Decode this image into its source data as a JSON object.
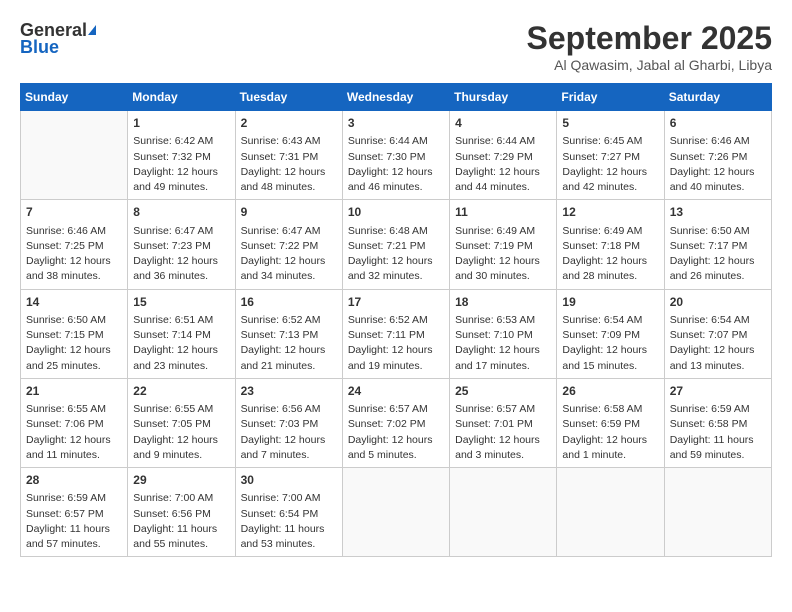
{
  "logo": {
    "general": "General",
    "blue": "Blue"
  },
  "title": "September 2025",
  "location": "Al Qawasim, Jabal al Gharbi, Libya",
  "days_of_week": [
    "Sunday",
    "Monday",
    "Tuesday",
    "Wednesday",
    "Thursday",
    "Friday",
    "Saturday"
  ],
  "weeks": [
    [
      {
        "day": "",
        "sunrise": "",
        "sunset": "",
        "daylight": "",
        "empty": true
      },
      {
        "day": "1",
        "sunrise": "Sunrise: 6:42 AM",
        "sunset": "Sunset: 7:32 PM",
        "daylight": "Daylight: 12 hours and 49 minutes."
      },
      {
        "day": "2",
        "sunrise": "Sunrise: 6:43 AM",
        "sunset": "Sunset: 7:31 PM",
        "daylight": "Daylight: 12 hours and 48 minutes."
      },
      {
        "day": "3",
        "sunrise": "Sunrise: 6:44 AM",
        "sunset": "Sunset: 7:30 PM",
        "daylight": "Daylight: 12 hours and 46 minutes."
      },
      {
        "day": "4",
        "sunrise": "Sunrise: 6:44 AM",
        "sunset": "Sunset: 7:29 PM",
        "daylight": "Daylight: 12 hours and 44 minutes."
      },
      {
        "day": "5",
        "sunrise": "Sunrise: 6:45 AM",
        "sunset": "Sunset: 7:27 PM",
        "daylight": "Daylight: 12 hours and 42 minutes."
      },
      {
        "day": "6",
        "sunrise": "Sunrise: 6:46 AM",
        "sunset": "Sunset: 7:26 PM",
        "daylight": "Daylight: 12 hours and 40 minutes."
      }
    ],
    [
      {
        "day": "7",
        "sunrise": "Sunrise: 6:46 AM",
        "sunset": "Sunset: 7:25 PM",
        "daylight": "Daylight: 12 hours and 38 minutes."
      },
      {
        "day": "8",
        "sunrise": "Sunrise: 6:47 AM",
        "sunset": "Sunset: 7:23 PM",
        "daylight": "Daylight: 12 hours and 36 minutes."
      },
      {
        "day": "9",
        "sunrise": "Sunrise: 6:47 AM",
        "sunset": "Sunset: 7:22 PM",
        "daylight": "Daylight: 12 hours and 34 minutes."
      },
      {
        "day": "10",
        "sunrise": "Sunrise: 6:48 AM",
        "sunset": "Sunset: 7:21 PM",
        "daylight": "Daylight: 12 hours and 32 minutes."
      },
      {
        "day": "11",
        "sunrise": "Sunrise: 6:49 AM",
        "sunset": "Sunset: 7:19 PM",
        "daylight": "Daylight: 12 hours and 30 minutes."
      },
      {
        "day": "12",
        "sunrise": "Sunrise: 6:49 AM",
        "sunset": "Sunset: 7:18 PM",
        "daylight": "Daylight: 12 hours and 28 minutes."
      },
      {
        "day": "13",
        "sunrise": "Sunrise: 6:50 AM",
        "sunset": "Sunset: 7:17 PM",
        "daylight": "Daylight: 12 hours and 26 minutes."
      }
    ],
    [
      {
        "day": "14",
        "sunrise": "Sunrise: 6:50 AM",
        "sunset": "Sunset: 7:15 PM",
        "daylight": "Daylight: 12 hours and 25 minutes."
      },
      {
        "day": "15",
        "sunrise": "Sunrise: 6:51 AM",
        "sunset": "Sunset: 7:14 PM",
        "daylight": "Daylight: 12 hours and 23 minutes."
      },
      {
        "day": "16",
        "sunrise": "Sunrise: 6:52 AM",
        "sunset": "Sunset: 7:13 PM",
        "daylight": "Daylight: 12 hours and 21 minutes."
      },
      {
        "day": "17",
        "sunrise": "Sunrise: 6:52 AM",
        "sunset": "Sunset: 7:11 PM",
        "daylight": "Daylight: 12 hours and 19 minutes."
      },
      {
        "day": "18",
        "sunrise": "Sunrise: 6:53 AM",
        "sunset": "Sunset: 7:10 PM",
        "daylight": "Daylight: 12 hours and 17 minutes."
      },
      {
        "day": "19",
        "sunrise": "Sunrise: 6:54 AM",
        "sunset": "Sunset: 7:09 PM",
        "daylight": "Daylight: 12 hours and 15 minutes."
      },
      {
        "day": "20",
        "sunrise": "Sunrise: 6:54 AM",
        "sunset": "Sunset: 7:07 PM",
        "daylight": "Daylight: 12 hours and 13 minutes."
      }
    ],
    [
      {
        "day": "21",
        "sunrise": "Sunrise: 6:55 AM",
        "sunset": "Sunset: 7:06 PM",
        "daylight": "Daylight: 12 hours and 11 minutes."
      },
      {
        "day": "22",
        "sunrise": "Sunrise: 6:55 AM",
        "sunset": "Sunset: 7:05 PM",
        "daylight": "Daylight: 12 hours and 9 minutes."
      },
      {
        "day": "23",
        "sunrise": "Sunrise: 6:56 AM",
        "sunset": "Sunset: 7:03 PM",
        "daylight": "Daylight: 12 hours and 7 minutes."
      },
      {
        "day": "24",
        "sunrise": "Sunrise: 6:57 AM",
        "sunset": "Sunset: 7:02 PM",
        "daylight": "Daylight: 12 hours and 5 minutes."
      },
      {
        "day": "25",
        "sunrise": "Sunrise: 6:57 AM",
        "sunset": "Sunset: 7:01 PM",
        "daylight": "Daylight: 12 hours and 3 minutes."
      },
      {
        "day": "26",
        "sunrise": "Sunrise: 6:58 AM",
        "sunset": "Sunset: 6:59 PM",
        "daylight": "Daylight: 12 hours and 1 minute."
      },
      {
        "day": "27",
        "sunrise": "Sunrise: 6:59 AM",
        "sunset": "Sunset: 6:58 PM",
        "daylight": "Daylight: 11 hours and 59 minutes."
      }
    ],
    [
      {
        "day": "28",
        "sunrise": "Sunrise: 6:59 AM",
        "sunset": "Sunset: 6:57 PM",
        "daylight": "Daylight: 11 hours and 57 minutes."
      },
      {
        "day": "29",
        "sunrise": "Sunrise: 7:00 AM",
        "sunset": "Sunset: 6:56 PM",
        "daylight": "Daylight: 11 hours and 55 minutes."
      },
      {
        "day": "30",
        "sunrise": "Sunrise: 7:00 AM",
        "sunset": "Sunset: 6:54 PM",
        "daylight": "Daylight: 11 hours and 53 minutes."
      },
      {
        "day": "",
        "sunrise": "",
        "sunset": "",
        "daylight": "",
        "empty": true
      },
      {
        "day": "",
        "sunrise": "",
        "sunset": "",
        "daylight": "",
        "empty": true
      },
      {
        "day": "",
        "sunrise": "",
        "sunset": "",
        "daylight": "",
        "empty": true
      },
      {
        "day": "",
        "sunrise": "",
        "sunset": "",
        "daylight": "",
        "empty": true
      }
    ]
  ]
}
